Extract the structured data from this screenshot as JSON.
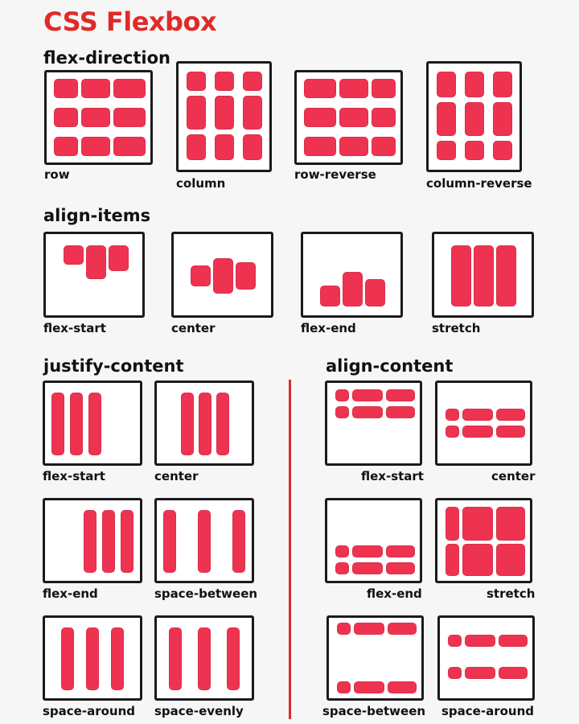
{
  "title": "CSS Flexbox",
  "accent_color": "#e02a2a",
  "block_color": "#ee3350",
  "sections": {
    "flex_direction": {
      "heading": "flex-direction",
      "captions": [
        "row",
        "column",
        "row-reverse",
        "column-reverse"
      ]
    },
    "align_items": {
      "heading": "align-items",
      "captions": [
        "flex-start",
        "center",
        "flex-end",
        "stretch"
      ]
    },
    "justify_content": {
      "heading": "justify-content",
      "captions": [
        "flex-start",
        "center",
        "flex-end",
        "space-between",
        "space-around",
        "space-evenly"
      ]
    },
    "align_content": {
      "heading": "align-content",
      "captions": [
        "flex-start",
        "center",
        "flex-end",
        "stretch",
        "space-between",
        "space-around"
      ]
    }
  }
}
